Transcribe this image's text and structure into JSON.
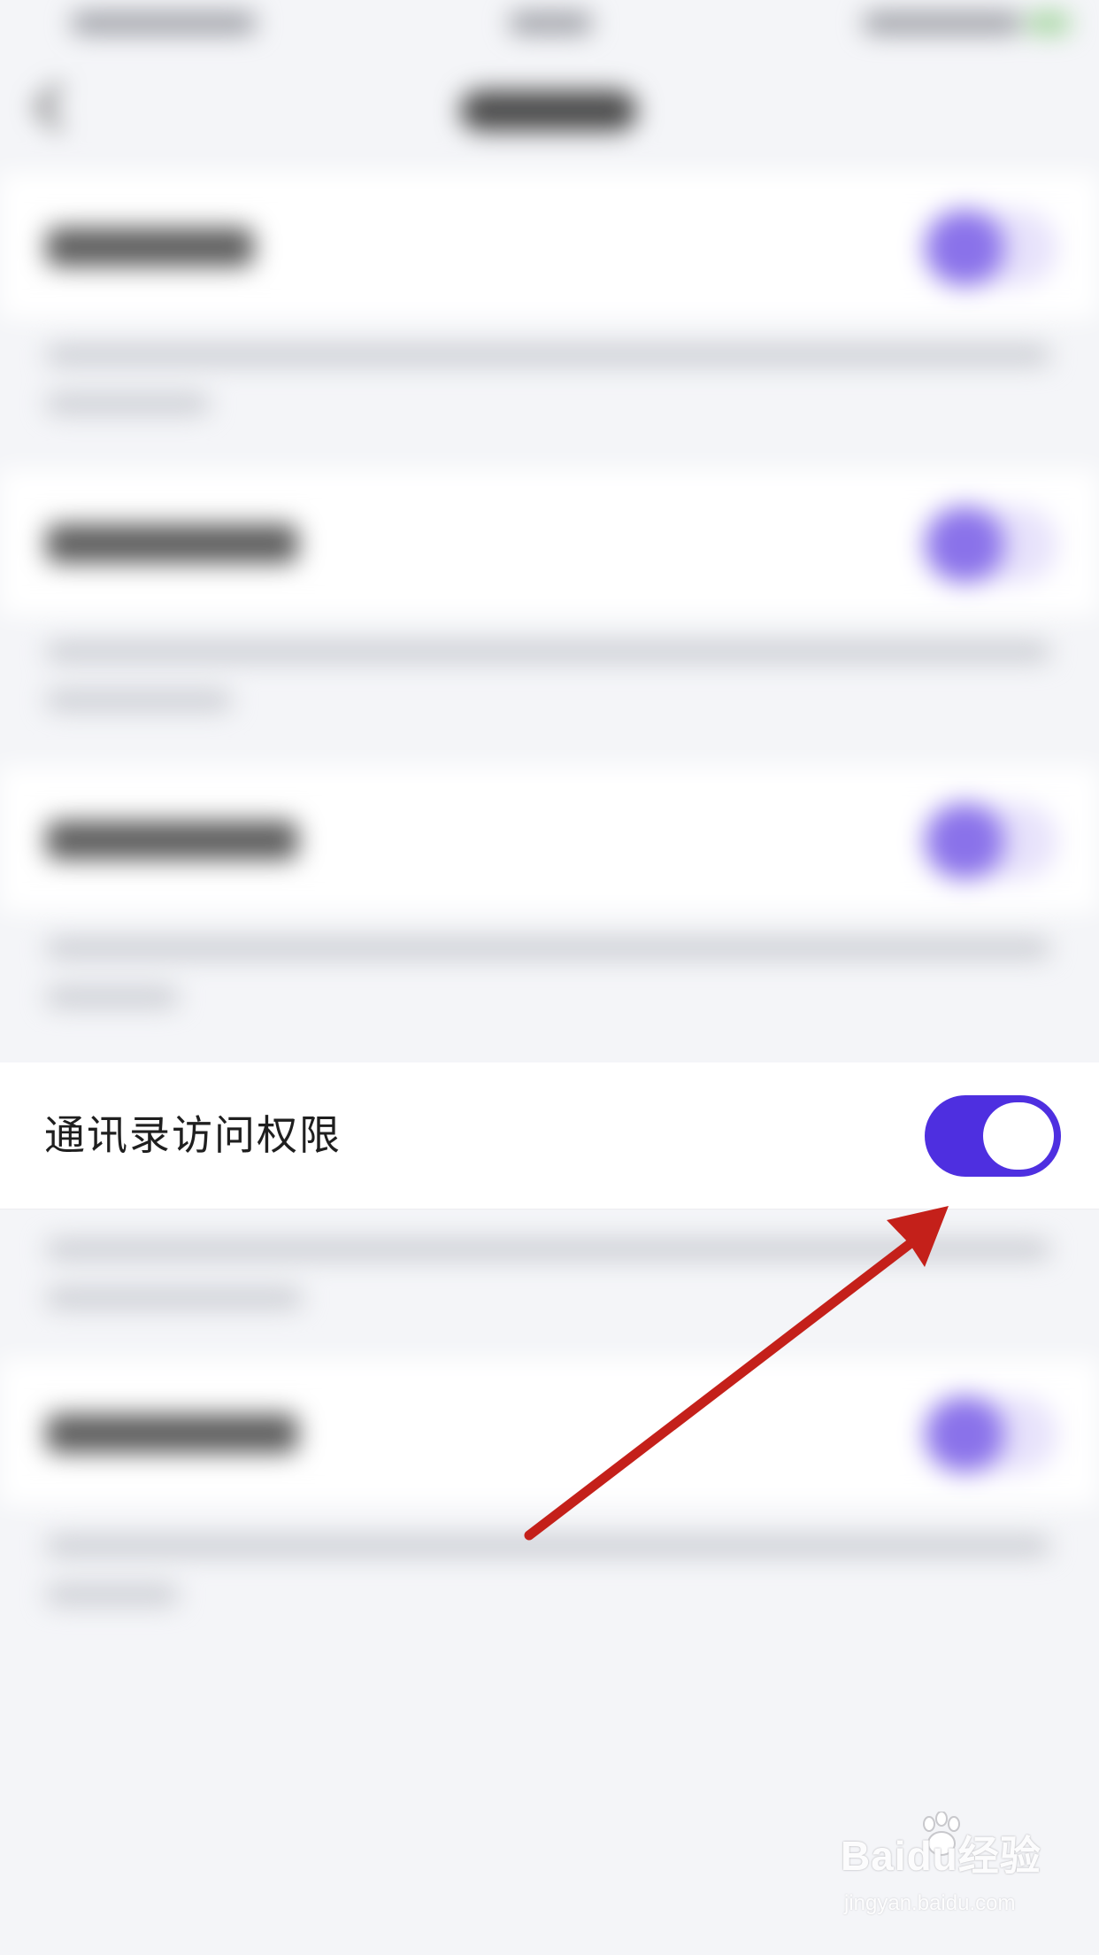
{
  "screen": {
    "highlighted_setting": {
      "label": "通讯录访问权限",
      "toggle_on": true
    }
  },
  "watermark": {
    "brand": "Baidu经验",
    "url": "jingyan.baidu.com"
  },
  "colors": {
    "background": "#f4f5f8",
    "toggle_on": "#4e2fe0",
    "toggle_knob": "#ffffff",
    "annotation_arrow": "#c4201a",
    "blurred_toggle": "#8a72ea"
  },
  "icons": {
    "back": "chevron-left-icon",
    "annotation": "red-arrow-annotation"
  }
}
